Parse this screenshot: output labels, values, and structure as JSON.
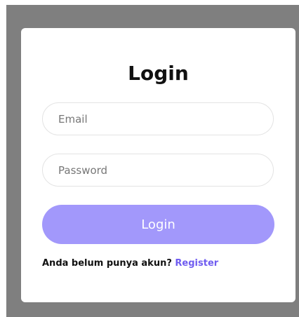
{
  "login_form": {
    "title": "Login",
    "email_placeholder": "Email",
    "password_placeholder": "Password",
    "submit_label": "Login",
    "register_prompt": "Anda belum punya akun?",
    "register_link": "Register"
  },
  "colors": {
    "overlay": "#7f7f7f",
    "card": "#ffffff",
    "button": "#a298fb",
    "link": "#6f5cf0"
  }
}
